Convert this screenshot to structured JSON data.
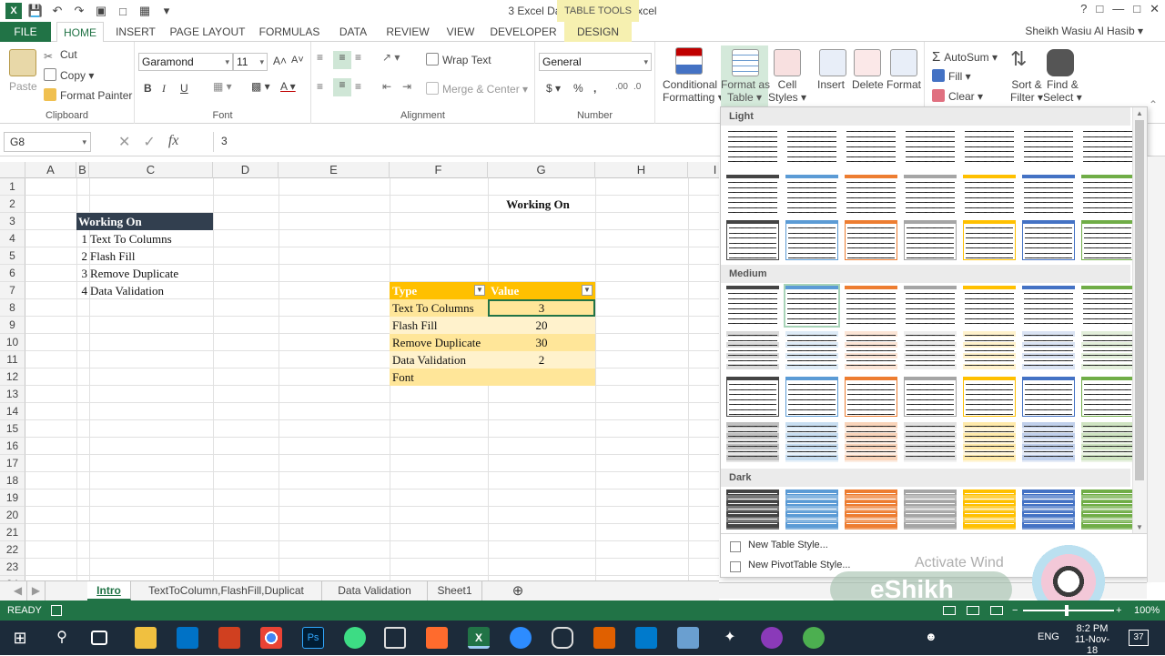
{
  "window": {
    "title": "3 Excel Data Tools.xlsx - Excel",
    "context_header": "TABLE TOOLS",
    "user": "Sheikh Wasiu Al Hasib",
    "help": "?",
    "controls": [
      "—",
      "□",
      "✕"
    ]
  },
  "tabs": [
    "FILE",
    "HOME",
    "INSERT",
    "PAGE LAYOUT",
    "FORMULAS",
    "DATA",
    "REVIEW",
    "VIEW",
    "DEVELOPER",
    "DESIGN"
  ],
  "ribbon": {
    "clipboard": {
      "label": "Clipboard",
      "paste": "Paste",
      "cut": "Cut",
      "copy": "Copy",
      "format_painter": "Format Painter"
    },
    "font": {
      "label": "Font",
      "name": "Garamond",
      "size": "11",
      "bold": "B",
      "italic": "I",
      "underline": "U"
    },
    "alignment": {
      "label": "Alignment",
      "wrap": "Wrap Text",
      "merge": "Merge & Center"
    },
    "number": {
      "label": "Number",
      "format": "General",
      "currency": "$",
      "percent": "%",
      "comma": ","
    },
    "styles": {
      "conditional": "Conditional",
      "conditional2": "Formatting",
      "format_table": "Format as",
      "format_table2": "Table",
      "cell_styles": "Cell",
      "cell_styles2": "Styles"
    },
    "cells": {
      "insert": "Insert",
      "delete": "Delete",
      "format": "Format"
    },
    "editing": {
      "autosum": "AutoSum",
      "fill": "Fill",
      "clear": "Clear",
      "sort": "Sort &",
      "sort2": "Filter",
      "find": "Find &",
      "find2": "Select"
    }
  },
  "formula_bar": {
    "name_box": "G8",
    "fx": "fx",
    "value": "3"
  },
  "columns": [
    "A",
    "B",
    "C",
    "D",
    "E",
    "F",
    "G",
    "H",
    "I"
  ],
  "rows": [
    "1",
    "2",
    "3",
    "4",
    "5",
    "6",
    "7",
    "8",
    "9",
    "10",
    "11",
    "12",
    "13",
    "14",
    "15",
    "16",
    "17",
    "18",
    "19",
    "20",
    "21",
    "22",
    "23",
    "24"
  ],
  "sheet": {
    "title_g2": "Working On",
    "list_header": "Working On",
    "list": [
      {
        "n": "1",
        "text": "Text To Columns"
      },
      {
        "n": "2",
        "text": "Flash Fill"
      },
      {
        "n": "3",
        "text": "Remove Duplicate"
      },
      {
        "n": "4",
        "text": "Data Validation"
      }
    ],
    "table_headers": [
      "Type",
      "Value"
    ],
    "table_rows": [
      {
        "type": "Text To Columns",
        "value": "3"
      },
      {
        "type": "Flash Fill",
        "value": "20"
      },
      {
        "type": "Remove Duplicate",
        "value": "30"
      },
      {
        "type": "Data Validation",
        "value": "2"
      },
      {
        "type": "Font",
        "value": ""
      }
    ]
  },
  "style_gallery": {
    "sections": [
      "Light",
      "Medium",
      "Dark"
    ],
    "palette": [
      "#444444",
      "#5b9bd5",
      "#ed7d31",
      "#a5a5a5",
      "#ffc000",
      "#4472c4",
      "#70ad47"
    ],
    "menu": [
      "New Table Style...",
      "New PivotTable Style..."
    ]
  },
  "sheet_tabs": [
    "Intro",
    "TextToColumn,FlashFill,Duplicat",
    "Data Validation",
    "Sheet1"
  ],
  "status": {
    "ready": "READY",
    "zoom": "100%"
  },
  "watermark": {
    "activate": "Activate Wind",
    "brand": "eShikh"
  },
  "taskbar": {
    "lang": "ENG",
    "time": "8:2 PM",
    "date": "11-Nov-18",
    "badge": "37"
  }
}
